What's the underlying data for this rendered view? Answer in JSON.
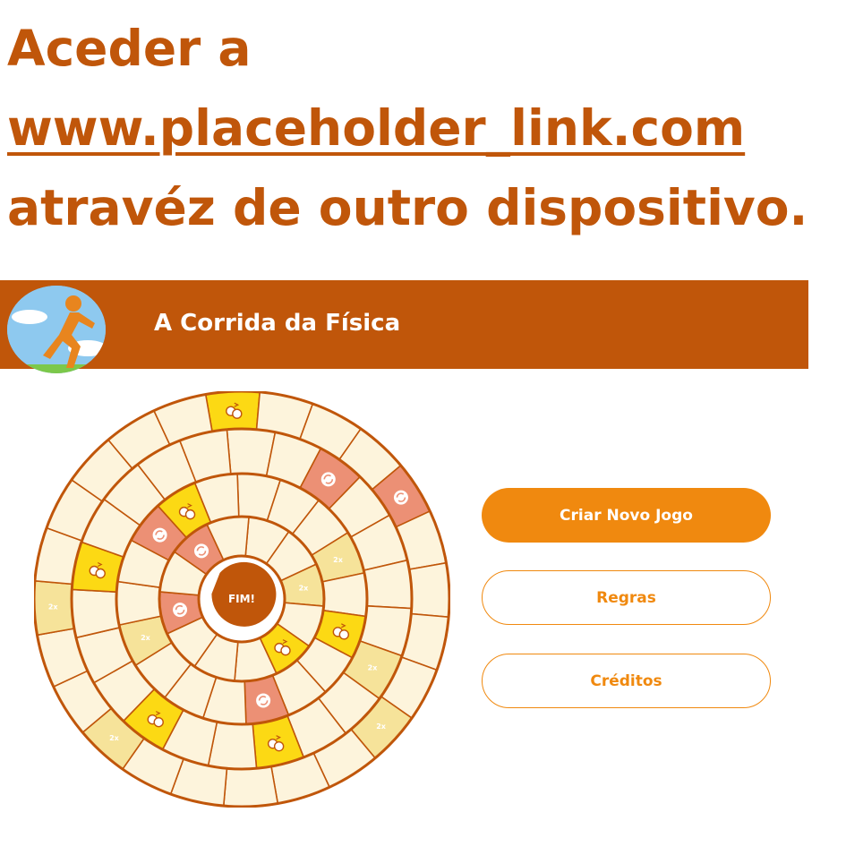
{
  "instructions": {
    "prefix": "Aceder a",
    "link": "www.placeholder_link.com",
    "suffix": "atravéz de outro dispositivo."
  },
  "header": {
    "title": "A Corrida da Física",
    "logo": "runner-logo"
  },
  "board": {
    "center_label": "FIM!",
    "double_label": "2x",
    "icons": [
      "swap-icon",
      "refresh-icon"
    ],
    "colors": {
      "cell": "#fdf4dc",
      "border": "#c0560a",
      "double": "#f6e39a",
      "swap": "#fcd914",
      "refresh": "#ec9075",
      "center": "#c0560a"
    }
  },
  "buttons": {
    "new_game": "Criar Novo Jogo",
    "rules": "Regras",
    "credits": "Créditos"
  },
  "colors": {
    "brand_dark": "#c0560a",
    "accent": "#f0890f"
  }
}
